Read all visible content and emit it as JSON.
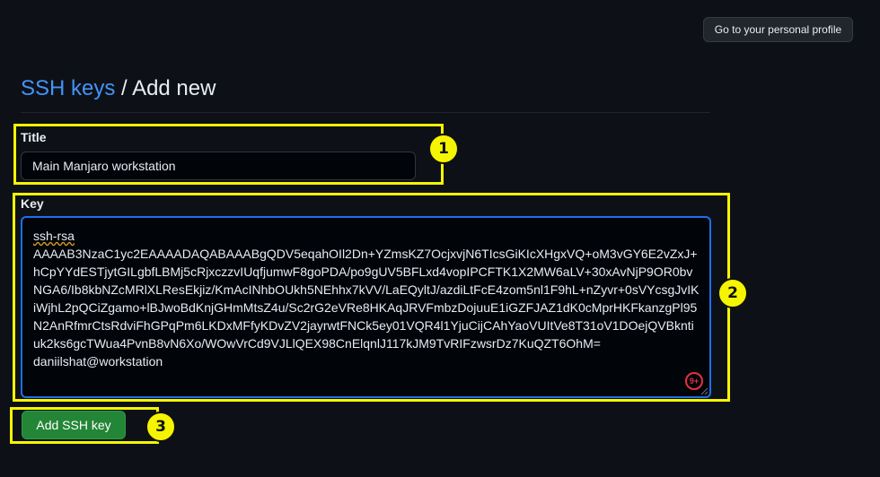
{
  "header": {
    "profile_button_label": "Go to your personal profile"
  },
  "breadcrumb": {
    "parent_link": "SSH keys",
    "separator": "/",
    "current": "Add new"
  },
  "form": {
    "title_label": "Title",
    "title_value": "Main Manjaro workstation",
    "key_label": "Key",
    "key_type": "ssh-rsa",
    "key_body": "AAAAB3NzaC1yc2EAAAADAQABAAABgQDV5eqahOIl2Dn+YZmsKZ7OcjxvjN6TIcsGiKIcXHgxVQ+oM3vGY6E2vZxJ+hCpYYdESTjytGILgbfLBMj5cRjxczzvIUqfjumwF8goPDA/po9gUV5BFLxd4vopIPCFTK1X2MW6aLV+30xAvNjP9OR0bvNGA6/Ib8kbNZcMRlXLResEkjiz/KmAcINhbOUkh5NEhhx7kVV/LaEQyltJ/azdiLtFcE4zom5nl1F9hL+nZyvr+0sVYcsgJvIKiWjhL2pQCiZgamo+lBJwoBdKnjGHmMtsZ4u/Sc2rG2eVRe8HKAqJRVFmbzDojuuE1iGZFJAZ1dK0cMprHKFkanzgPl95N2AnRfmrCtsRdviFhGPqPm6LKDxMFfyKDvZV2jayrwtFNCk5ey01VQR4l1YjuCijCAhYaoVUItVe8T31oV1DOejQVBkntiuk2ks6gcTWua4PvnB8vN6Xo/WOwVrCd9VJLlQEX98CnElqnlJ117kJM9TvRIFzwsrDz7KuQZT6OhM=",
    "key_comment": "daniilshat@workstation",
    "grammarly_count": "9+",
    "submit_label": "Add SSH key"
  },
  "callouts": [
    "1",
    "2",
    "3"
  ],
  "colors": {
    "background": "#0d1117",
    "link": "#4493f8",
    "callout": "#f5f500",
    "primary_button": "#238636",
    "focus_border": "#1f6feb"
  }
}
